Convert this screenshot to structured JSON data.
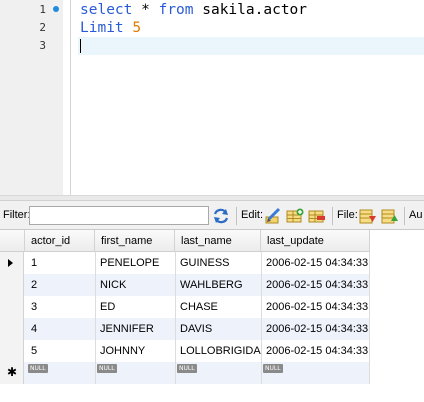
{
  "editor": {
    "lines": [
      {
        "number": "1",
        "parts": [
          {
            "t": "select",
            "c": "kw"
          },
          {
            "t": " * ",
            "c": ""
          },
          {
            "t": "from",
            "c": "kw"
          },
          {
            "t": " sakila.actor",
            "c": ""
          }
        ]
      },
      {
        "number": "2",
        "parts": [
          {
            "t": "Limit",
            "c": "kw"
          },
          {
            "t": " ",
            "c": ""
          },
          {
            "t": "5",
            "c": "num"
          }
        ]
      },
      {
        "number": "3",
        "parts": []
      }
    ],
    "colors": {
      "keyword": "#2a5bd6",
      "number": "#e07b00",
      "current_line": "#eaf6fb",
      "breakpoint_dot": "#1e8cde"
    }
  },
  "toolbar": {
    "filter_label": "Filter:",
    "filter_value": "",
    "edit_label": "Edit:",
    "file_label": "File:",
    "autofit_label": "Au",
    "icons": [
      "refresh-filter-icon",
      "edit-cell-icon",
      "insert-row-icon",
      "delete-row-icon",
      "export-icon",
      "import-icon"
    ]
  },
  "grid": {
    "columns": [
      "actor_id",
      "first_name",
      "last_name",
      "last_update"
    ],
    "rows": [
      [
        "1",
        "PENELOPE",
        "GUINESS",
        "2006-02-15 04:34:33"
      ],
      [
        "2",
        "NICK",
        "WAHLBERG",
        "2006-02-15 04:34:33"
      ],
      [
        "3",
        "ED",
        "CHASE",
        "2006-02-15 04:34:33"
      ],
      [
        "4",
        "JENNIFER",
        "DAVIS",
        "2006-02-15 04:34:33"
      ],
      [
        "5",
        "JOHNNY",
        "LOLLOBRIGIDA",
        "2006-02-15 04:34:33"
      ]
    ],
    "new_row_marker": "✱",
    "null_label": "NULL",
    "colors": {
      "odd_row": "#ffffff",
      "even_row": "#eef2fb"
    }
  }
}
